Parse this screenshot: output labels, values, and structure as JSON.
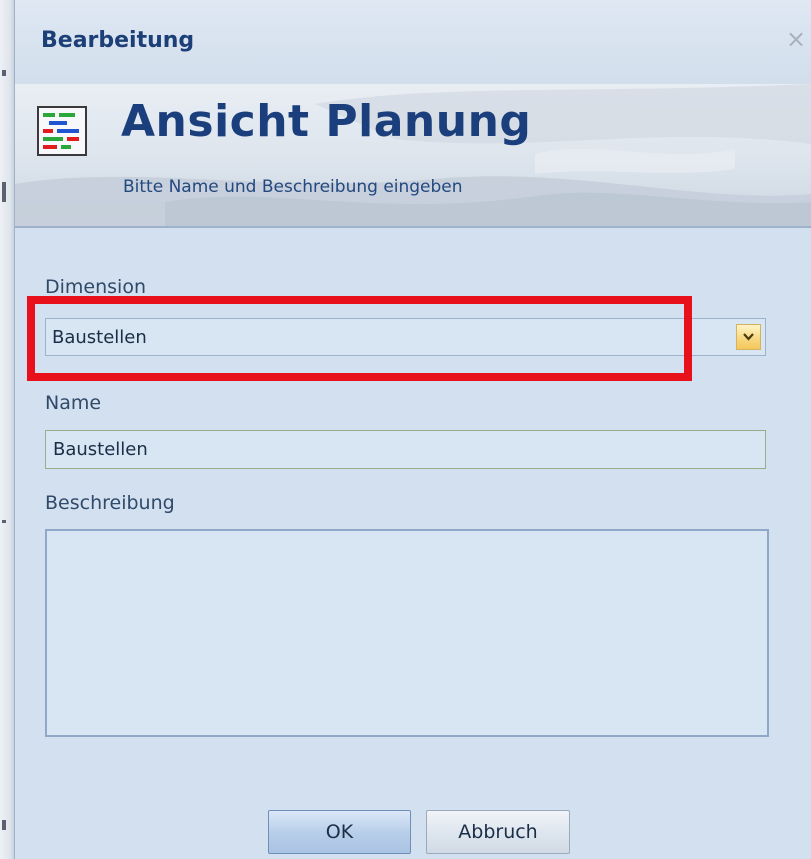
{
  "dialog": {
    "window_title": "Bearbeitung",
    "close_symbol": "×",
    "header_title": "Ansicht Planung",
    "header_subtitle": "Bitte Name und Beschreibung eingeben",
    "header_icon": "schedule-bars-icon"
  },
  "form": {
    "dimension_label": "Dimension",
    "dimension_value": "Baustellen",
    "name_label": "Name",
    "name_value": "Baustellen",
    "description_label": "Beschreibung",
    "description_value": ""
  },
  "buttons": {
    "ok_label": "OK",
    "cancel_label": "Abbruch"
  },
  "colors": {
    "highlight": "#e8101b",
    "title_blue": "#1b3f7c",
    "dialog_background": "#d3e0ef"
  }
}
